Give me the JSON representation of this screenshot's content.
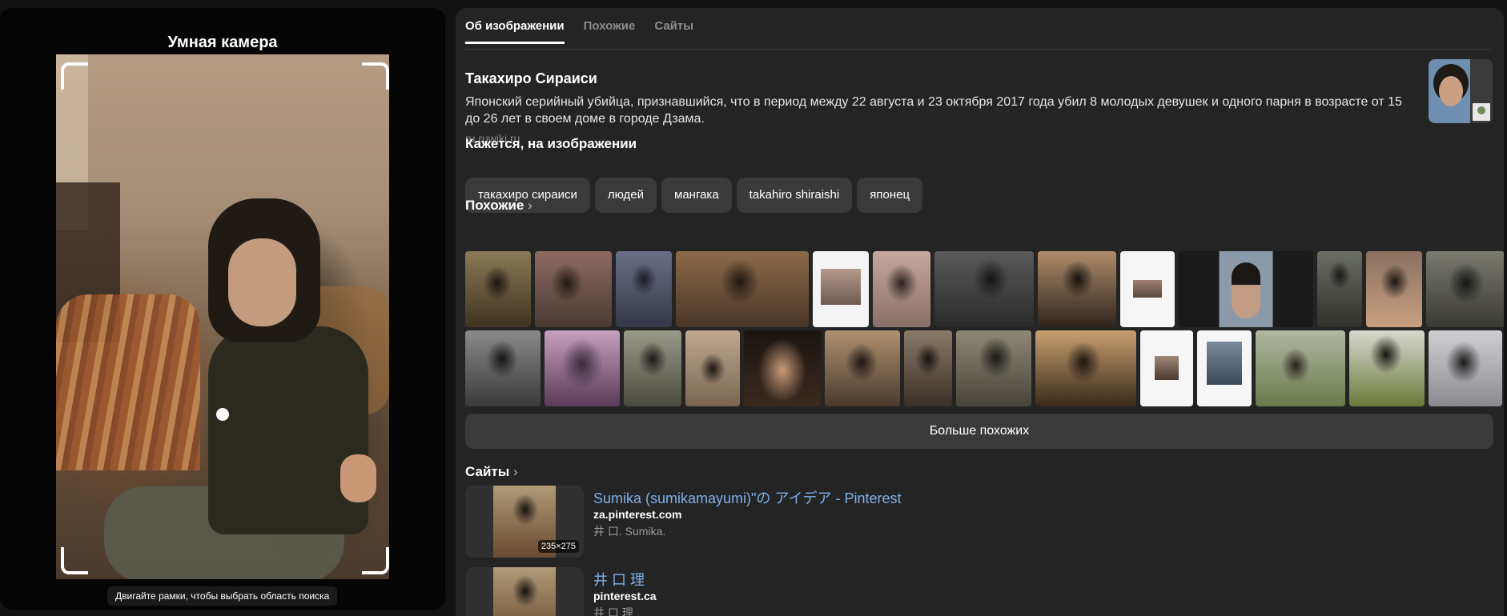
{
  "smart_camera": {
    "title": "Умная камера",
    "hint": "Двигайте рамки, чтобы выбрать область поиска"
  },
  "tabs": [
    {
      "label": "Об изображении",
      "active": true
    },
    {
      "label": "Похожие",
      "active": false
    },
    {
      "label": "Сайты",
      "active": false
    }
  ],
  "entity": {
    "title": "Такахиро Сираиси",
    "description": "Японский серийный убийца, признавшийся, что в период между 22 августа и 23 октября 2017 года убил 8 молодых девушек и одного парня в возрасте от 15 до 26 лет в своем доме в городе Дзама.",
    "source": "ru.ruwiki.ru"
  },
  "seems_section": {
    "title": "Кажется, на изображении",
    "chips": [
      "такахиро сираиси",
      "людей",
      "мангака",
      "takahiro shiraishi",
      "японец"
    ]
  },
  "similar_section": {
    "title": "Похожие",
    "chevron": "›",
    "more_button": "Больше похожих"
  },
  "sites_section": {
    "title": "Сайты",
    "chevron": "›",
    "items": [
      {
        "title": "Sumika (sumikamayumi)\"の アイデア - Pinterest",
        "domain": "za.pinterest.com",
        "snippet": "井 口. Sumika.",
        "size": "235×275"
      },
      {
        "title": "井 口 理",
        "domain": "pinterest.ca",
        "snippet": "井 口 理",
        "size": ""
      }
    ]
  },
  "colors": {
    "page_bg": "#121212",
    "panel_bg": "#242424",
    "chip_bg": "#3a3a3a",
    "link": "#7fb0e8"
  }
}
